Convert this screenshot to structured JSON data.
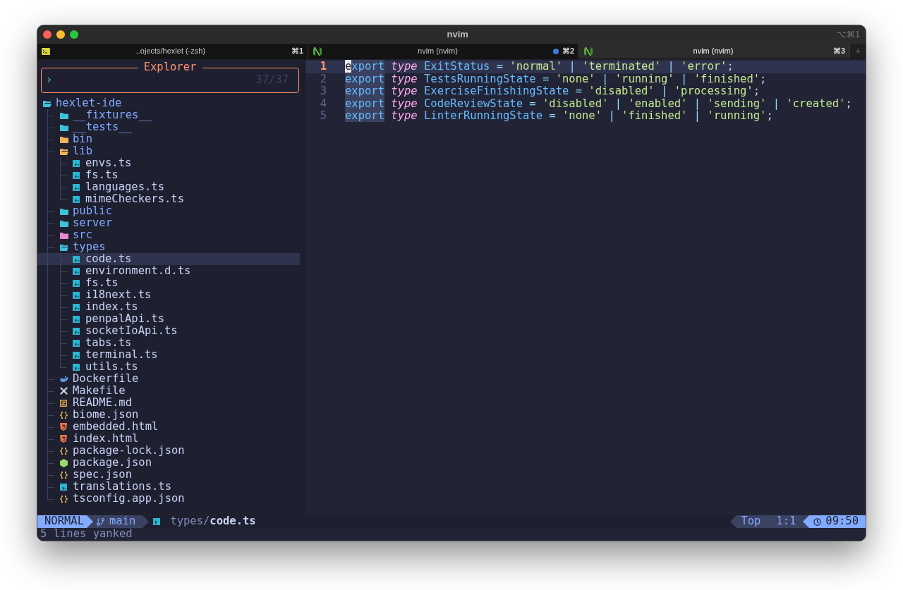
{
  "window": {
    "title": "nvim",
    "shortcut": "⌥⌘1"
  },
  "tabs": [
    {
      "kind": "terminal",
      "title": "..ojects/hexlet (-zsh)",
      "shortcut": "⌘1",
      "activity": false,
      "selected": false
    },
    {
      "kind": "app",
      "title": "nvim (nvim)",
      "shortcut": "⌘2",
      "activity": true,
      "selected": false
    },
    {
      "kind": "app",
      "title": "nvim (nvim)",
      "shortcut": "⌘3",
      "activity": false,
      "selected": true
    }
  ],
  "new_tab": "+",
  "explorer": {
    "title": "Explorer",
    "prompt": "›",
    "count": "37/37"
  },
  "tree": [
    {
      "name": "hexlet-ide",
      "kind": "folder",
      "color": "#3fc1d9",
      "expanded": true,
      "selected": false,
      "children": [
        {
          "name": "__fixtures__",
          "kind": "folder",
          "color": "#3fc1d9",
          "expanded": false,
          "selected": false
        },
        {
          "name": "__tests__",
          "kind": "folder",
          "color": "#3fc1d9",
          "expanded": false,
          "selected": false
        },
        {
          "name": "bin",
          "kind": "folder",
          "color": "#f0b35a",
          "expanded": false,
          "selected": false
        },
        {
          "name": "lib",
          "kind": "folder",
          "color": "#f0b35a",
          "expanded": true,
          "selected": false,
          "children": [
            {
              "name": "envs.ts",
              "kind": "ts",
              "color": "#2bb5d0",
              "selected": false
            },
            {
              "name": "fs.ts",
              "kind": "ts",
              "color": "#2bb5d0",
              "selected": false
            },
            {
              "name": "languages.ts",
              "kind": "ts",
              "color": "#2bb5d0",
              "selected": false
            },
            {
              "name": "mimeCheckers.ts",
              "kind": "ts",
              "color": "#2bb5d0",
              "selected": false
            }
          ]
        },
        {
          "name": "public",
          "kind": "folder",
          "color": "#3fc1d9",
          "expanded": false,
          "selected": false
        },
        {
          "name": "server",
          "kind": "folder",
          "color": "#3fc1d9",
          "expanded": false,
          "selected": false
        },
        {
          "name": "src",
          "kind": "folder",
          "color": "#e88ac9",
          "expanded": false,
          "selected": false
        },
        {
          "name": "types",
          "kind": "folder",
          "color": "#3fc1d9",
          "expanded": true,
          "selected": false,
          "children": [
            {
              "name": "code.ts",
              "kind": "ts",
              "color": "#2bb5d0",
              "selected": true
            },
            {
              "name": "environment.d.ts",
              "kind": "ts",
              "color": "#2bb5d0",
              "selected": false
            },
            {
              "name": "fs.ts",
              "kind": "ts",
              "color": "#2bb5d0",
              "selected": false
            },
            {
              "name": "i18next.ts",
              "kind": "ts",
              "color": "#2bb5d0",
              "selected": false
            },
            {
              "name": "index.ts",
              "kind": "ts",
              "color": "#2bb5d0",
              "selected": false
            },
            {
              "name": "penpalApi.ts",
              "kind": "ts",
              "color": "#2bb5d0",
              "selected": false
            },
            {
              "name": "socketIoApi.ts",
              "kind": "ts",
              "color": "#2bb5d0",
              "selected": false
            },
            {
              "name": "tabs.ts",
              "kind": "ts",
              "color": "#2bb5d0",
              "selected": false
            },
            {
              "name": "terminal.ts",
              "kind": "ts",
              "color": "#2bb5d0",
              "selected": false
            },
            {
              "name": "utils.ts",
              "kind": "ts",
              "color": "#2bb5d0",
              "selected": false
            }
          ]
        },
        {
          "name": "Dockerfile",
          "kind": "docker",
          "color": "#5c9ee8",
          "selected": false
        },
        {
          "name": "Makefile",
          "kind": "tools",
          "color": "#d0d4e0",
          "selected": false
        },
        {
          "name": "README.md",
          "kind": "readme",
          "color": "#e0a050",
          "selected": false
        },
        {
          "name": "biome.json",
          "kind": "json",
          "color": "#e0b050",
          "selected": false
        },
        {
          "name": "embedded.html",
          "kind": "html",
          "color": "#f0764a",
          "selected": false
        },
        {
          "name": "index.html",
          "kind": "html",
          "color": "#f0764a",
          "selected": false
        },
        {
          "name": "package-lock.json",
          "kind": "json",
          "color": "#e0b050",
          "selected": false
        },
        {
          "name": "package.json",
          "kind": "node",
          "color": "#9bd86a",
          "selected": false
        },
        {
          "name": "spec.json",
          "kind": "json",
          "color": "#e0b050",
          "selected": false
        },
        {
          "name": "translations.ts",
          "kind": "ts",
          "color": "#2bb5d0",
          "selected": false
        },
        {
          "name": "tsconfig.app.json",
          "kind": "json",
          "color": "#e0b050",
          "selected": false
        }
      ]
    }
  ],
  "editor": {
    "lines": [
      {
        "number": "1",
        "current": true,
        "tokens": [
          {
            "text": "e",
            "kind": "cursor"
          },
          {
            "text": "xport",
            "kind": "keyword",
            "highlighted": true
          },
          {
            "text": "type",
            "kind": "storage"
          },
          {
            "text": "ExitStatus",
            "kind": "ident"
          },
          {
            "text": "=",
            "kind": "op"
          },
          {
            "text": "'normal'",
            "kind": "string"
          },
          {
            "text": "|",
            "kind": "op"
          },
          {
            "text": "'terminated'",
            "kind": "string"
          },
          {
            "text": "|",
            "kind": "op"
          },
          {
            "text": "'error'",
            "kind": "string"
          },
          {
            "text": ";",
            "kind": "punct"
          }
        ]
      },
      {
        "number": "2",
        "current": false,
        "tokens": [
          {
            "text": "export",
            "kind": "keyword",
            "highlighted": true
          },
          {
            "text": "type",
            "kind": "storage"
          },
          {
            "text": "TestsRunningState",
            "kind": "ident"
          },
          {
            "text": "=",
            "kind": "op"
          },
          {
            "text": "'none'",
            "kind": "string"
          },
          {
            "text": "|",
            "kind": "op"
          },
          {
            "text": "'running'",
            "kind": "string"
          },
          {
            "text": "|",
            "kind": "op"
          },
          {
            "text": "'finished'",
            "kind": "string"
          },
          {
            "text": ";",
            "kind": "punct"
          }
        ]
      },
      {
        "number": "3",
        "current": false,
        "tokens": [
          {
            "text": "export",
            "kind": "keyword",
            "highlighted": true
          },
          {
            "text": "type",
            "kind": "storage"
          },
          {
            "text": "ExerciseFinishingState",
            "kind": "ident"
          },
          {
            "text": "=",
            "kind": "op"
          },
          {
            "text": "'disabled'",
            "kind": "string"
          },
          {
            "text": "|",
            "kind": "op"
          },
          {
            "text": "'processing'",
            "kind": "string"
          },
          {
            "text": ";",
            "kind": "punct"
          }
        ]
      },
      {
        "number": "4",
        "current": false,
        "tokens": [
          {
            "text": "export",
            "kind": "keyword",
            "highlighted": true
          },
          {
            "text": "type",
            "kind": "storage"
          },
          {
            "text": "CodeReviewState",
            "kind": "ident"
          },
          {
            "text": "=",
            "kind": "op"
          },
          {
            "text": "'disabled'",
            "kind": "string"
          },
          {
            "text": "|",
            "kind": "op"
          },
          {
            "text": "'enabled'",
            "kind": "string"
          },
          {
            "text": "|",
            "kind": "op"
          },
          {
            "text": "'sending'",
            "kind": "string"
          },
          {
            "text": "|",
            "kind": "op"
          },
          {
            "text": "'created'",
            "kind": "string"
          },
          {
            "text": ";",
            "kind": "punct"
          }
        ]
      },
      {
        "number": "5",
        "current": false,
        "tokens": [
          {
            "text": "export",
            "kind": "keyword",
            "highlighted": true
          },
          {
            "text": "type",
            "kind": "storage"
          },
          {
            "text": "LinterRunningState",
            "kind": "ident"
          },
          {
            "text": "=",
            "kind": "op"
          },
          {
            "text": "'none'",
            "kind": "string"
          },
          {
            "text": "|",
            "kind": "op"
          },
          {
            "text": "'finished'",
            "kind": "string"
          },
          {
            "text": "|",
            "kind": "op"
          },
          {
            "text": "'running'",
            "kind": "string"
          },
          {
            "text": ";",
            "kind": "punct"
          }
        ]
      }
    ]
  },
  "status_bar": {
    "mode": "NORMAL",
    "branch": "main",
    "file_dir": "types/",
    "file_name": "code.ts",
    "position": "Top",
    "cursor": "1:1",
    "time": "09:50"
  },
  "message": "5 lines yanked"
}
